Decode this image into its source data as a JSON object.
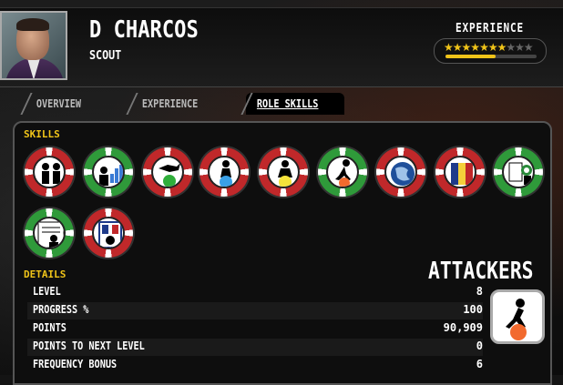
{
  "player": {
    "name": "D CHARCOS",
    "role": "SCOUT"
  },
  "experience": {
    "label": "EXPERIENCE",
    "stars_filled": 7,
    "stars_total": 10,
    "progress": 0.55
  },
  "tabs": [
    {
      "label": "OVERVIEW",
      "active": false
    },
    {
      "label": "EXPERIENCE",
      "active": false
    },
    {
      "label": "ROLE SKILLS",
      "active": true
    }
  ],
  "skills_label": "SKILLS",
  "skills": [
    {
      "icon": "twins-icon",
      "ring": "red"
    },
    {
      "icon": "stats-chart-icon",
      "ring": "green"
    },
    {
      "icon": "goalkeeper-icon",
      "ring": "red"
    },
    {
      "icon": "defender-icon",
      "ring": "red"
    },
    {
      "icon": "midfielder-icon",
      "ring": "red"
    },
    {
      "icon": "attacker-icon",
      "ring": "green"
    },
    {
      "icon": "globe-icon",
      "ring": "red"
    },
    {
      "icon": "national-flag-icon",
      "ring": "red"
    },
    {
      "icon": "youth-scout-icon",
      "ring": "green"
    },
    {
      "icon": "contract-icon",
      "ring": "green"
    },
    {
      "icon": "team-badge-icon",
      "ring": "red"
    }
  ],
  "details_label": "DETAILS",
  "focus": "ATTACKERS",
  "details": [
    {
      "key": "LEVEL",
      "value": "8"
    },
    {
      "key": "PROGRESS %",
      "value": "100"
    },
    {
      "key": "POINTS",
      "value": "90,909"
    },
    {
      "key": "POINTS TO NEXT LEVEL",
      "value": "0"
    },
    {
      "key": "FREQUENCY BONUS",
      "value": "6"
    }
  ],
  "colors": {
    "accent": "#f0c419",
    "ring_red": "#c0282a",
    "ring_green": "#2f9a3a"
  }
}
